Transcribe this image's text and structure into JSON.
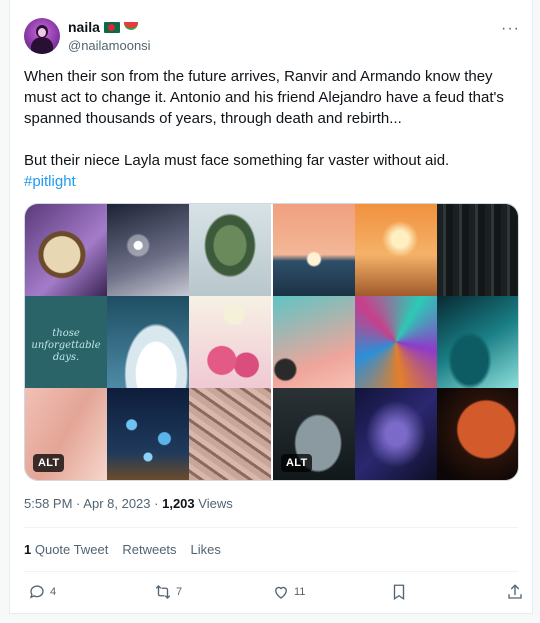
{
  "user": {
    "display_name": "naila",
    "handle": "@nailamoonsi",
    "badges": [
      "bangladesh-flag-emoji",
      "watermelon-emoji"
    ],
    "avatar": "profile-avatar"
  },
  "menu": {
    "more_label": "···"
  },
  "tweet": {
    "paragraph_1": "When their son from the future arrives, Ranvir and Armando know they must act to change it. Antonio and his friend Alejandro have a feud that's spanned thousands of years, through death and rebirth...",
    "paragraph_2": "But their niece Layla must face something far vaster without aid.",
    "hashtag": "#pitlight"
  },
  "media": {
    "images": [
      {
        "label": "moodboard-left",
        "alt_badge": "ALT",
        "tile_text": "those unforgettable days."
      },
      {
        "label": "moodboard-right",
        "alt_badge": "ALT"
      }
    ]
  },
  "meta": {
    "time": "5:58 PM",
    "sep1": "·",
    "date": "Apr 8, 2023",
    "sep2": "·",
    "views_count": "1,203",
    "views_label": "Views"
  },
  "stats": {
    "quote_count": "1",
    "quote_label": "Quote Tweet",
    "retweets_label": "Retweets",
    "likes_label": "Likes"
  },
  "actions": {
    "reply_count": "4",
    "retweet_count": "7",
    "like_count": "11",
    "bookmark_count": "",
    "share_count": ""
  },
  "colors": {
    "accent": "#1d9bf0",
    "text": "#0f1419",
    "muted": "#536471"
  }
}
